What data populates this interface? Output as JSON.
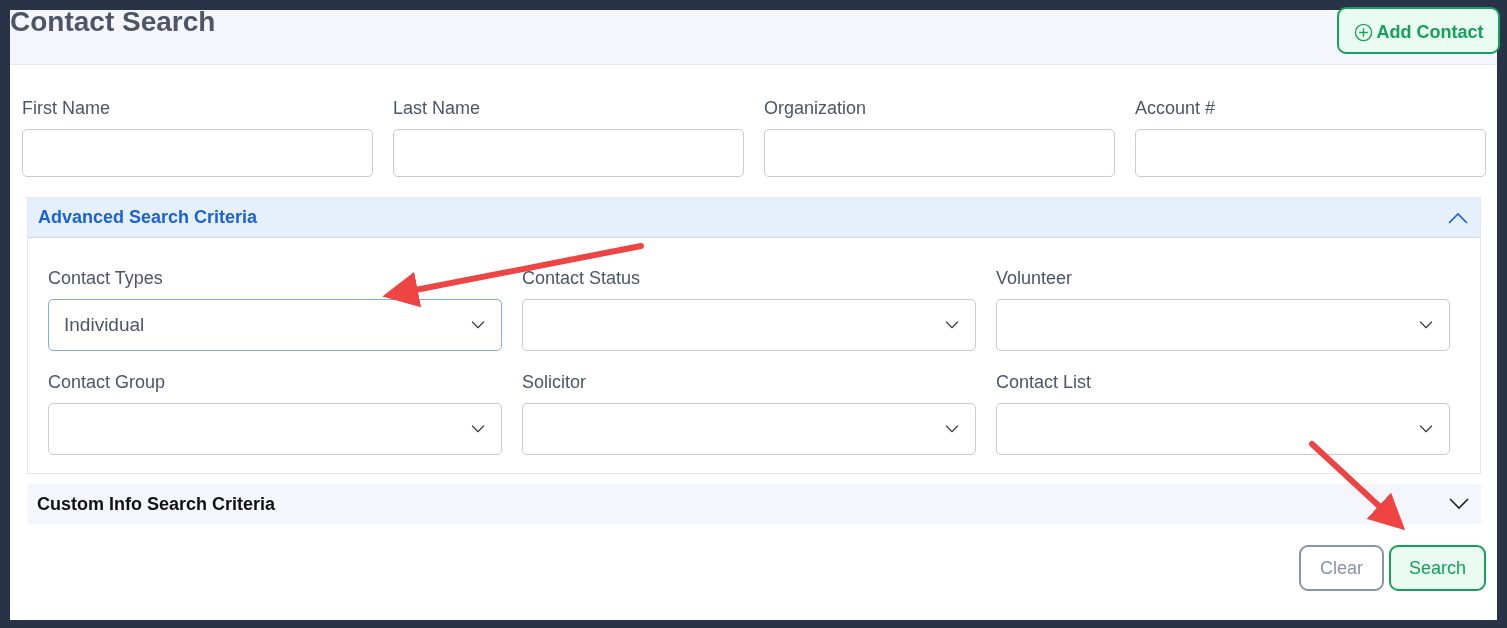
{
  "header": {
    "title": "Contact Search",
    "add_button": "Add Contact"
  },
  "fields": [
    {
      "label": "First Name"
    },
    {
      "label": "Last Name"
    },
    {
      "label": "Organization"
    },
    {
      "label": "Account #"
    }
  ],
  "sections": [
    {
      "title": "Advanced Search Criteria",
      "expanded": true,
      "fields": [
        {
          "label": "Contact Types",
          "value": "Individual",
          "focused": true
        },
        {
          "label": "Contact Status",
          "focused": false
        },
        {
          "label": "Volunteer",
          "focused": false
        },
        {
          "label": "Contact Group",
          "focused": false
        },
        {
          "label": "Solicitor",
          "focused": false
        },
        {
          "label": "Contact List",
          "focused": false
        }
      ]
    },
    {
      "title": "Custom Info Search Criteria",
      "expanded": false
    }
  ],
  "buttons": [
    {
      "label": "Clear",
      "kind": "secondary"
    },
    {
      "label": "Search",
      "kind": "primary"
    }
  ]
}
